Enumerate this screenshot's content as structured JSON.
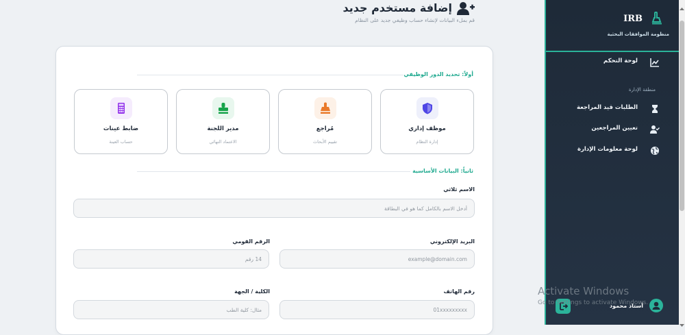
{
  "header": {
    "title": "إضافة مستخدم جديد",
    "subtitle": "قم بملء البيانات لإنشاء حساب وظيفي جديد على النظام"
  },
  "sidebar": {
    "brand": "IRB",
    "brand_sub": "منظومة الموافقات البحثية",
    "items": [
      {
        "label": "لوحة التحكم",
        "icon": "chart-line-icon"
      },
      {
        "label": "الطلبات قيد المراجعة",
        "icon": "hourglass-icon"
      },
      {
        "label": "تعيين المراجعين",
        "icon": "user-check-icon"
      },
      {
        "label": "لوحة معلومات الإدارة",
        "icon": "globe-icon"
      }
    ],
    "section_label": "منطقة الإدارة",
    "user_name": "أستاذ محمود"
  },
  "form": {
    "section1_title": "أولاً: تحديد الدور الوظيفي",
    "roles": [
      {
        "title": "موظف إداري",
        "desc": "إدارة النظام",
        "color": "#4f46e5",
        "bg": "#eef0fb",
        "icon": "shield-icon"
      },
      {
        "title": "مُراجع",
        "desc": "تقييم الأبحاث",
        "color": "#ea7a2a",
        "bg": "#fdf1e7",
        "icon": "stamp-icon"
      },
      {
        "title": "مدير اللجنة",
        "desc": "الاعتماد النهائي",
        "color": "#16a34a",
        "bg": "#e8f7ee",
        "icon": "stamp-icon"
      },
      {
        "title": "ضابط عينات",
        "desc": "حساب العينة",
        "color": "#9333ea",
        "bg": "#f5ecfd",
        "icon": "calculator-icon"
      }
    ],
    "section2_title": "ثانياً: البيانات الأساسية",
    "fullname": {
      "label": "الاسم ثلاثي",
      "placeholder": "أدخل الاسم بالكامل كما هو في البطاقة"
    },
    "email": {
      "label": "البريد الإلكتروني",
      "placeholder": "example@domain.com"
    },
    "national_id": {
      "label": "الرقم القومي",
      "placeholder": "14 رقم"
    },
    "phone": {
      "label": "رقم الهاتف",
      "placeholder": "01xxxxxxxxx"
    },
    "faculty": {
      "label": "الكلية / الجهة",
      "placeholder": "مثال: كلية الطب"
    }
  },
  "watermark": {
    "line1": "Activate Windows",
    "line2": "Go to Settings to activate Windows."
  }
}
